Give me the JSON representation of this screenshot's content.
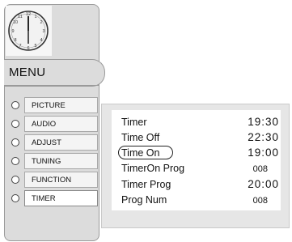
{
  "menu": {
    "title": "MENU"
  },
  "sidebar": {
    "items": [
      {
        "label": "PICTURE"
      },
      {
        "label": "AUDIO"
      },
      {
        "label": "ADJUST"
      },
      {
        "label": "TUNING"
      },
      {
        "label": "FUNCTION"
      },
      {
        "label": "TIMER"
      }
    ],
    "selected_index": 5
  },
  "timer_panel": {
    "rows": [
      {
        "label": "Timer",
        "value": "19:30"
      },
      {
        "label": "Time Off",
        "value": "22:30"
      },
      {
        "label": "Time On",
        "value": "19:00"
      },
      {
        "label": "TimerOn Prog",
        "value": "008"
      },
      {
        "label": "Timer Prog",
        "value": "20:00"
      },
      {
        "label": "Prog Num",
        "value": "008"
      }
    ],
    "focused_index": 2
  },
  "clock": {
    "icon": "clock-icon",
    "numerals": [
      "11",
      "12",
      "1",
      "10",
      "2",
      "9",
      "3",
      "8",
      "4",
      "7",
      "6",
      "5"
    ]
  },
  "colors": {
    "panel": "#dcdcdc",
    "item_bg": "#f4f4f4",
    "sub_panel": "#e6e6e6",
    "radio_selected": "#bdbdbd"
  }
}
